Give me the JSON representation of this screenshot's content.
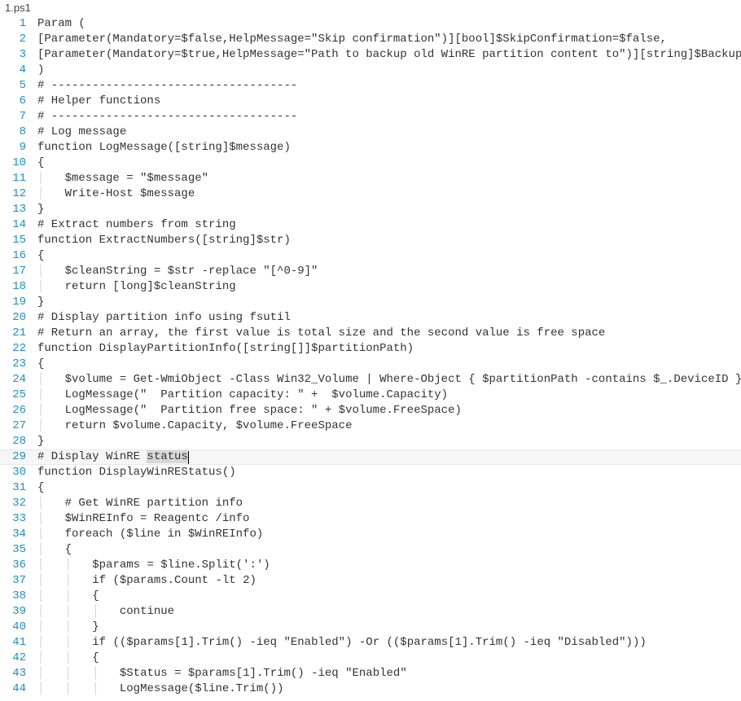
{
  "file": {
    "name": "1.ps1"
  },
  "lines": [
    {
      "n": 1,
      "indent": "",
      "pre": "",
      "sel": "",
      "suf": "Param ("
    },
    {
      "n": 2,
      "indent": "",
      "pre": "",
      "sel": "",
      "suf": "[Parameter(Mandatory=$false,HelpMessage=\"Skip confirmation\")][bool]$SkipConfirmation=$false,"
    },
    {
      "n": 3,
      "indent": "",
      "pre": "",
      "sel": "",
      "suf": "[Parameter(Mandatory=$true,HelpMessage=\"Path to backup old WinRE partition content to\")][string]$BackupFolder"
    },
    {
      "n": 4,
      "indent": "",
      "pre": "",
      "sel": "",
      "suf": ")"
    },
    {
      "n": 5,
      "indent": "",
      "pre": "",
      "sel": "",
      "suf": "# ------------------------------------"
    },
    {
      "n": 6,
      "indent": "",
      "pre": "",
      "sel": "",
      "suf": "# Helper functions"
    },
    {
      "n": 7,
      "indent": "",
      "pre": "",
      "sel": "",
      "suf": "# ------------------------------------"
    },
    {
      "n": 8,
      "indent": "",
      "pre": "",
      "sel": "",
      "suf": "# Log message"
    },
    {
      "n": 9,
      "indent": "",
      "pre": "",
      "sel": "",
      "suf": "function LogMessage([string]$message)"
    },
    {
      "n": 10,
      "indent": "",
      "pre": "",
      "sel": "",
      "suf": "{"
    },
    {
      "n": 11,
      "indent": "    ",
      "pre": "",
      "sel": "",
      "suf": "$message = \"$message\""
    },
    {
      "n": 12,
      "indent": "    ",
      "pre": "",
      "sel": "",
      "suf": "Write-Host $message"
    },
    {
      "n": 13,
      "indent": "",
      "pre": "",
      "sel": "",
      "suf": "}"
    },
    {
      "n": 14,
      "indent": "",
      "pre": "",
      "sel": "",
      "suf": "# Extract numbers from string"
    },
    {
      "n": 15,
      "indent": "",
      "pre": "",
      "sel": "",
      "suf": "function ExtractNumbers([string]$str)"
    },
    {
      "n": 16,
      "indent": "",
      "pre": "",
      "sel": "",
      "suf": "{"
    },
    {
      "n": 17,
      "indent": "    ",
      "pre": "",
      "sel": "",
      "suf": "$cleanString = $str -replace \"[^0-9]\""
    },
    {
      "n": 18,
      "indent": "    ",
      "pre": "",
      "sel": "",
      "suf": "return [long]$cleanString"
    },
    {
      "n": 19,
      "indent": "",
      "pre": "",
      "sel": "",
      "suf": "}"
    },
    {
      "n": 20,
      "indent": "",
      "pre": "",
      "sel": "",
      "suf": "# Display partition info using fsutil"
    },
    {
      "n": 21,
      "indent": "",
      "pre": "",
      "sel": "",
      "suf": "# Return an array, the first value is total size and the second value is free space"
    },
    {
      "n": 22,
      "indent": "",
      "pre": "",
      "sel": "",
      "suf": "function DisplayPartitionInfo([string[]]$partitionPath)"
    },
    {
      "n": 23,
      "indent": "",
      "pre": "",
      "sel": "",
      "suf": "{"
    },
    {
      "n": 24,
      "indent": "    ",
      "pre": "",
      "sel": "",
      "suf": "$volume = Get-WmiObject -Class Win32_Volume | Where-Object { $partitionPath -contains $_.DeviceID }"
    },
    {
      "n": 25,
      "indent": "    ",
      "pre": "",
      "sel": "",
      "suf": "LogMessage(\"  Partition capacity: \" +  $volume.Capacity)"
    },
    {
      "n": 26,
      "indent": "    ",
      "pre": "",
      "sel": "",
      "suf": "LogMessage(\"  Partition free space: \" + $volume.FreeSpace)"
    },
    {
      "n": 27,
      "indent": "    ",
      "pre": "",
      "sel": "",
      "suf": "return $volume.Capacity, $volume.FreeSpace"
    },
    {
      "n": 28,
      "indent": "",
      "pre": "",
      "sel": "",
      "suf": "}"
    },
    {
      "n": 29,
      "current": true,
      "indent": "",
      "pre": "# Display WinRE ",
      "sel": "status",
      "suf": "",
      "caret": true
    },
    {
      "n": 30,
      "indent": "",
      "pre": "",
      "sel": "",
      "suf": "function DisplayWinREStatus()"
    },
    {
      "n": 31,
      "indent": "",
      "pre": "",
      "sel": "",
      "suf": "{"
    },
    {
      "n": 32,
      "indent": "    ",
      "pre": "",
      "sel": "",
      "suf": "# Get WinRE partition info"
    },
    {
      "n": 33,
      "indent": "    ",
      "pre": "",
      "sel": "",
      "suf": "$WinREInfo = Reagentc /info"
    },
    {
      "n": 34,
      "indent": "    ",
      "pre": "",
      "sel": "",
      "suf": "foreach ($line in $WinREInfo)"
    },
    {
      "n": 35,
      "indent": "    ",
      "pre": "",
      "sel": "",
      "suf": "{"
    },
    {
      "n": 36,
      "indent": "        ",
      "pre": "",
      "sel": "",
      "suf": "$params = $line.Split(':')"
    },
    {
      "n": 37,
      "indent": "        ",
      "pre": "",
      "sel": "",
      "suf": "if ($params.Count -lt 2)"
    },
    {
      "n": 38,
      "indent": "        ",
      "pre": "",
      "sel": "",
      "suf": "{"
    },
    {
      "n": 39,
      "indent": "            ",
      "pre": "",
      "sel": "",
      "suf": "continue"
    },
    {
      "n": 40,
      "indent": "        ",
      "pre": "",
      "sel": "",
      "suf": "}"
    },
    {
      "n": 41,
      "indent": "        ",
      "pre": "",
      "sel": "",
      "suf": "if (($params[1].Trim() -ieq \"Enabled\") -Or (($params[1].Trim() -ieq \"Disabled\")))"
    },
    {
      "n": 42,
      "indent": "        ",
      "pre": "",
      "sel": "",
      "suf": "{"
    },
    {
      "n": 43,
      "indent": "            ",
      "pre": "",
      "sel": "",
      "suf": "$Status = $params[1].Trim() -ieq \"Enabled\""
    },
    {
      "n": 44,
      "indent": "            ",
      "pre": "",
      "sel": "",
      "suf": "LogMessage($line.Trim())"
    }
  ]
}
